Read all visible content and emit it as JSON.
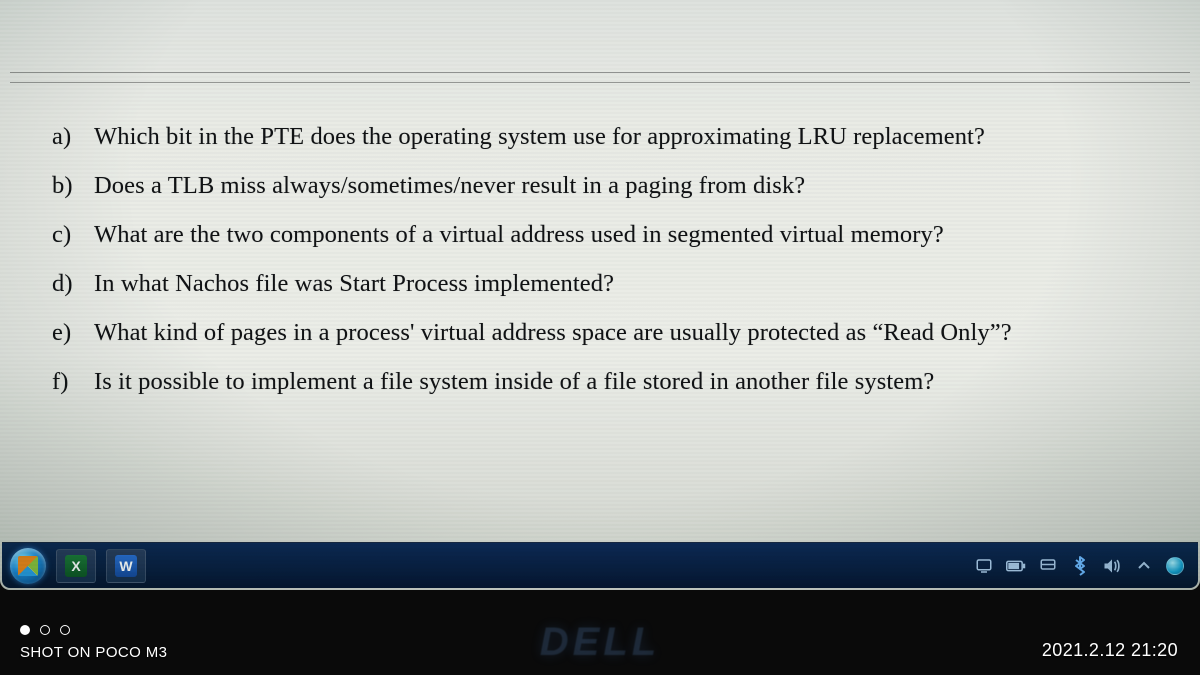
{
  "questions": [
    {
      "label": "a)",
      "text": "Which bit in the PTE does the operating system use for approximating LRU replacement?"
    },
    {
      "label": "b)",
      "text": "Does a TLB miss always/sometimes/never result in a paging from disk?"
    },
    {
      "label": "c)",
      "text": "What are the two components of a virtual address used in segmented virtual memory?"
    },
    {
      "label": "d)",
      "text": "In what Nachos file was Start Process implemented?"
    },
    {
      "label": "e)",
      "text": "What kind of pages in a process' virtual address space are usually protected as “Read Only”?"
    },
    {
      "label": "f)",
      "text": "Is it possible to implement a file system inside of a file stored in another file system?"
    }
  ],
  "taskbar": {
    "excel_char": "X",
    "word_char": "W"
  },
  "phone": {
    "shot_label": "SHOT ON POCO M3",
    "timestamp": "2021.2.12 21:20"
  },
  "brand": "DELL"
}
